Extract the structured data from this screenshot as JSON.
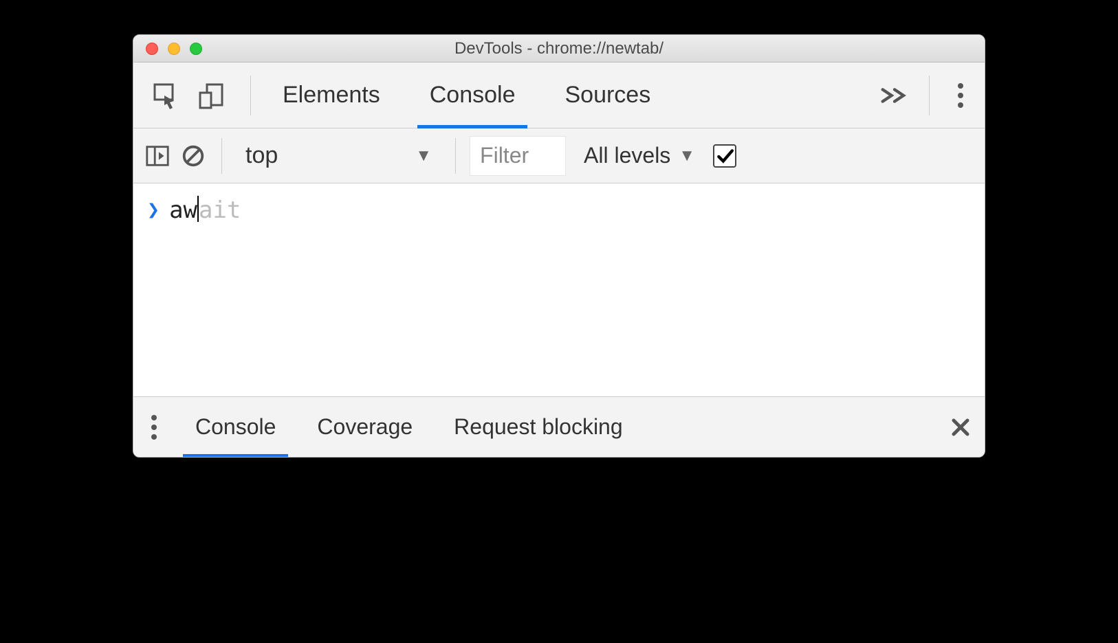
{
  "window": {
    "title": "DevTools - chrome://newtab/"
  },
  "mainTabs": {
    "items": [
      {
        "label": "Elements",
        "active": false
      },
      {
        "label": "Console",
        "active": true
      },
      {
        "label": "Sources",
        "active": false
      }
    ]
  },
  "consoleToolbar": {
    "context": "top",
    "filterPlaceholder": "Filter",
    "levelsLabel": "All levels",
    "preserveChecked": true
  },
  "consoleInput": {
    "typed": "aw",
    "ghost": "ait"
  },
  "drawer": {
    "tabs": [
      {
        "label": "Console",
        "active": true
      },
      {
        "label": "Coverage",
        "active": false
      },
      {
        "label": "Request blocking",
        "active": false
      }
    ]
  }
}
